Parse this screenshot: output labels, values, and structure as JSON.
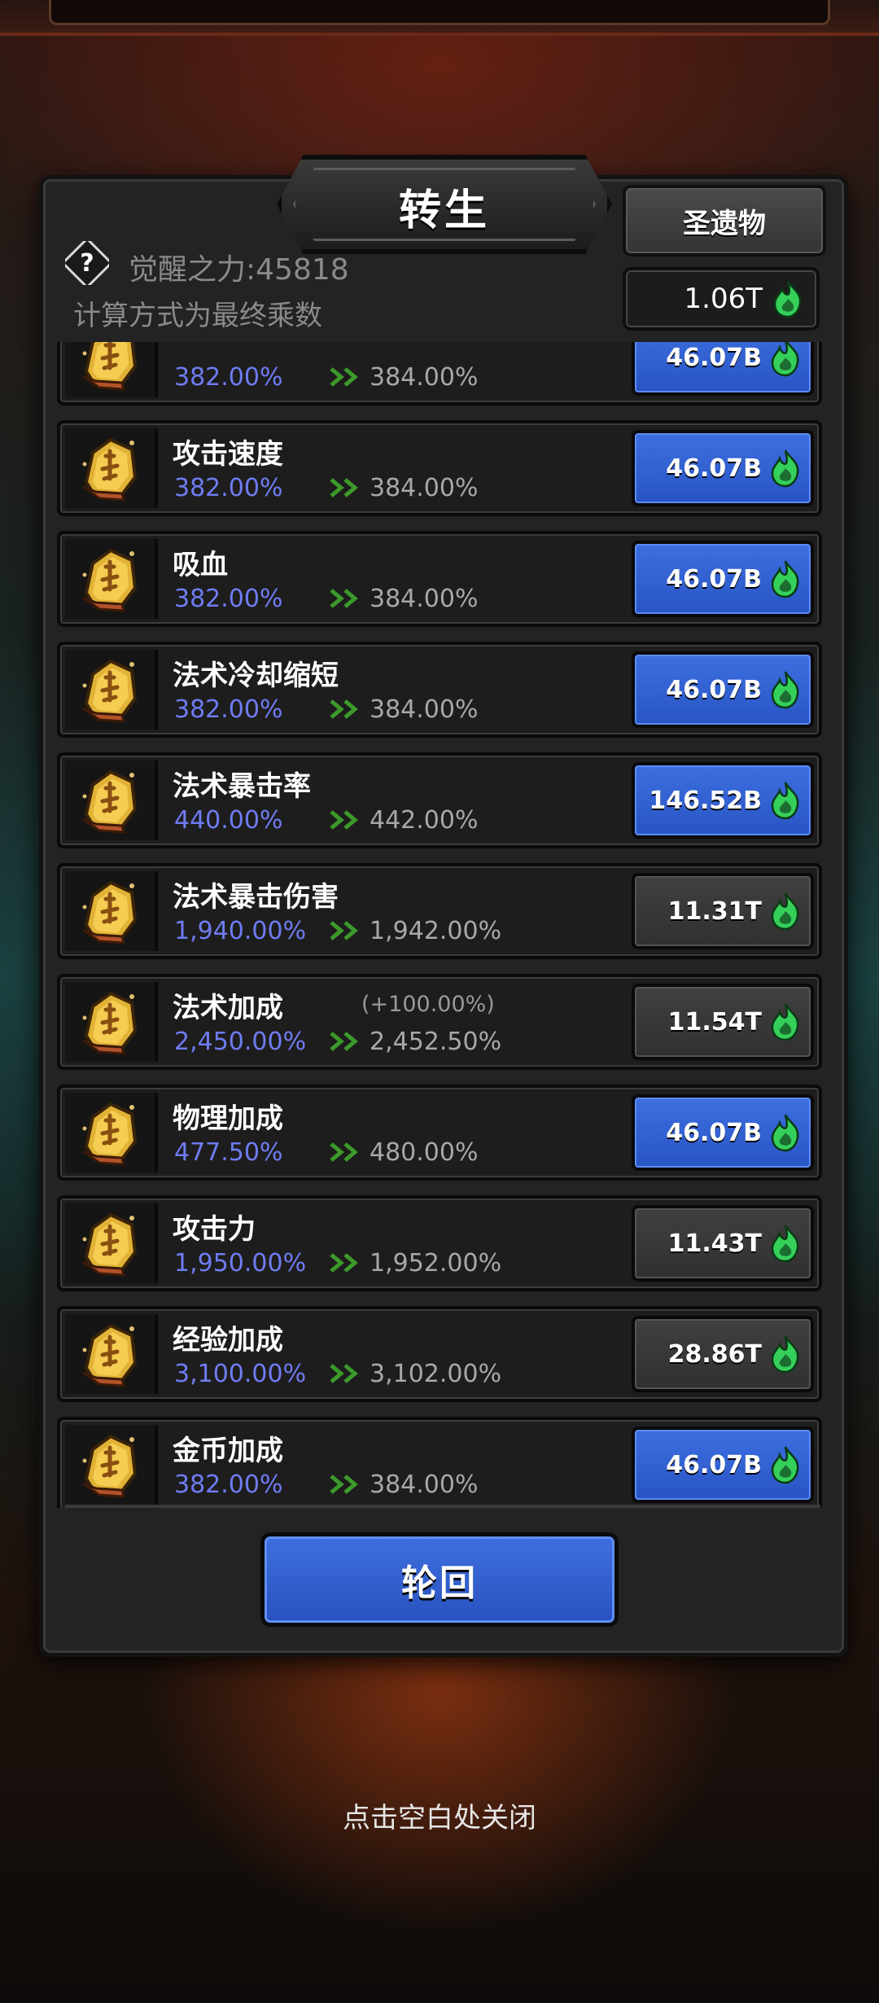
{
  "header": {
    "title": "转生",
    "relic_button": "圣遗物",
    "currency_amount": "1.06T",
    "awaken_power": "觉醒之力:45818",
    "formula_note": "计算方式为最终乘数"
  },
  "stats": [
    {
      "name": "",
      "extra": "",
      "current": "382.00%",
      "next": "384.00%",
      "cost": "46.07B",
      "style": "blue"
    },
    {
      "name": "攻击速度",
      "extra": "",
      "current": "382.00%",
      "next": "384.00%",
      "cost": "46.07B",
      "style": "blue"
    },
    {
      "name": "吸血",
      "extra": "",
      "current": "382.00%",
      "next": "384.00%",
      "cost": "46.07B",
      "style": "blue"
    },
    {
      "name": "法术冷却缩短",
      "extra": "",
      "current": "382.00%",
      "next": "384.00%",
      "cost": "46.07B",
      "style": "blue"
    },
    {
      "name": "法术暴击率",
      "extra": "",
      "current": "440.00%",
      "next": "442.00%",
      "cost": "146.52B",
      "style": "blue"
    },
    {
      "name": "法术暴击伤害",
      "extra": "",
      "current": "1,940.00%",
      "next": "1,942.00%",
      "cost": "11.31T",
      "style": "gray"
    },
    {
      "name": "法术加成",
      "extra": "(+100.00%)",
      "current": "2,450.00%",
      "next": "2,452.50%",
      "cost": "11.54T",
      "style": "gray"
    },
    {
      "name": "物理加成",
      "extra": "",
      "current": "477.50%",
      "next": "480.00%",
      "cost": "46.07B",
      "style": "blue"
    },
    {
      "name": "攻击力",
      "extra": "",
      "current": "1,950.00%",
      "next": "1,952.00%",
      "cost": "11.43T",
      "style": "gray"
    },
    {
      "name": "经验加成",
      "extra": "",
      "current": "3,100.00%",
      "next": "3,102.00%",
      "cost": "28.86T",
      "style": "gray"
    },
    {
      "name": "金币加成",
      "extra": "",
      "current": "382.00%",
      "next": "384.00%",
      "cost": "46.07B",
      "style": "blue"
    }
  ],
  "footer": {
    "cycle_button": "轮回",
    "close_hint": "点击空白处关闭"
  },
  "icons": {
    "rune": "rune-stone-icon",
    "currency": "green-soul-flame-icon",
    "arrow": "double-chevron-right-icon",
    "help": "question-mark-icon"
  },
  "colors": {
    "blue_button": "#2f5fd4",
    "current_value": "#6f7cf2",
    "flame": "#35d05a"
  }
}
